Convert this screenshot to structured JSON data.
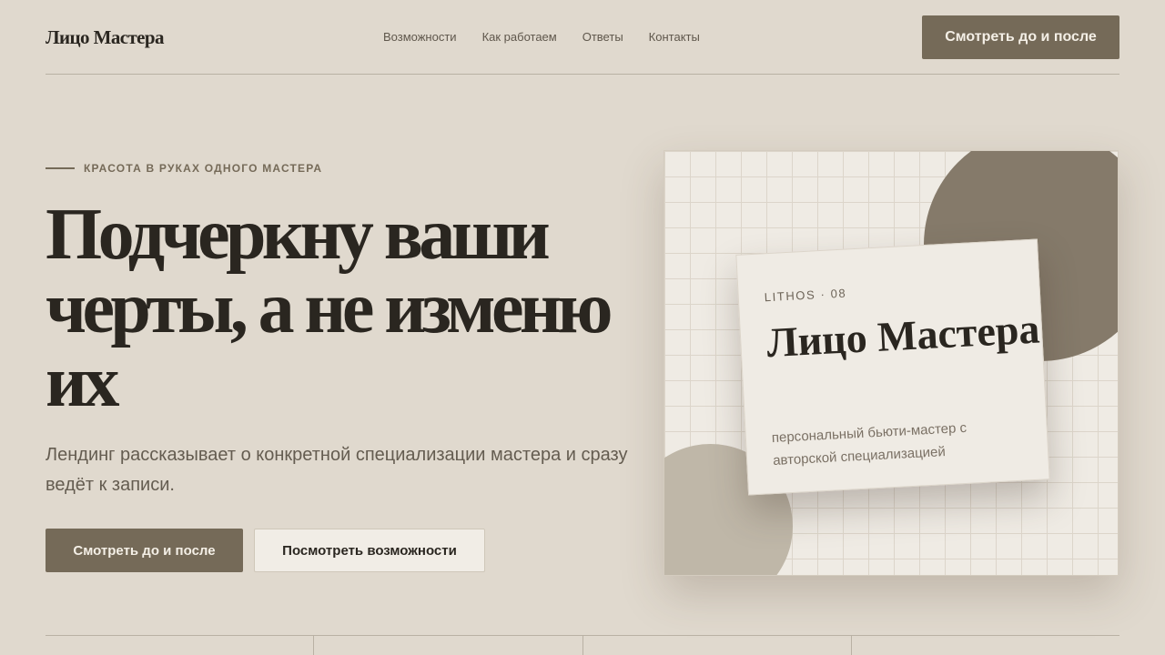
{
  "header": {
    "logo": "Лицо Мастера",
    "nav": [
      "Возможности",
      "Как работаем",
      "Ответы",
      "Контакты"
    ],
    "cta": "Смотреть до и после"
  },
  "hero": {
    "eyebrow": "КРАСОТА В РУКАХ ОДНОГО МАСТЕРА",
    "title": "Подчеркну ваши черты, а не изменю их",
    "subtitle": "Лендинг рассказывает о конкретной специализации мастера и сразу ведёт к записи.",
    "primary_cta": "Смотреть до и после",
    "secondary_cta": "Посмотреть возможности"
  },
  "card": {
    "tag": "LITHOS · 08",
    "title": "Лицо Мастера",
    "description": "персональный бьюти-мастер с авторской специализацией"
  },
  "colors": {
    "background": "#e0d9ce",
    "accent": "#756a58",
    "text": "#2a2620"
  }
}
